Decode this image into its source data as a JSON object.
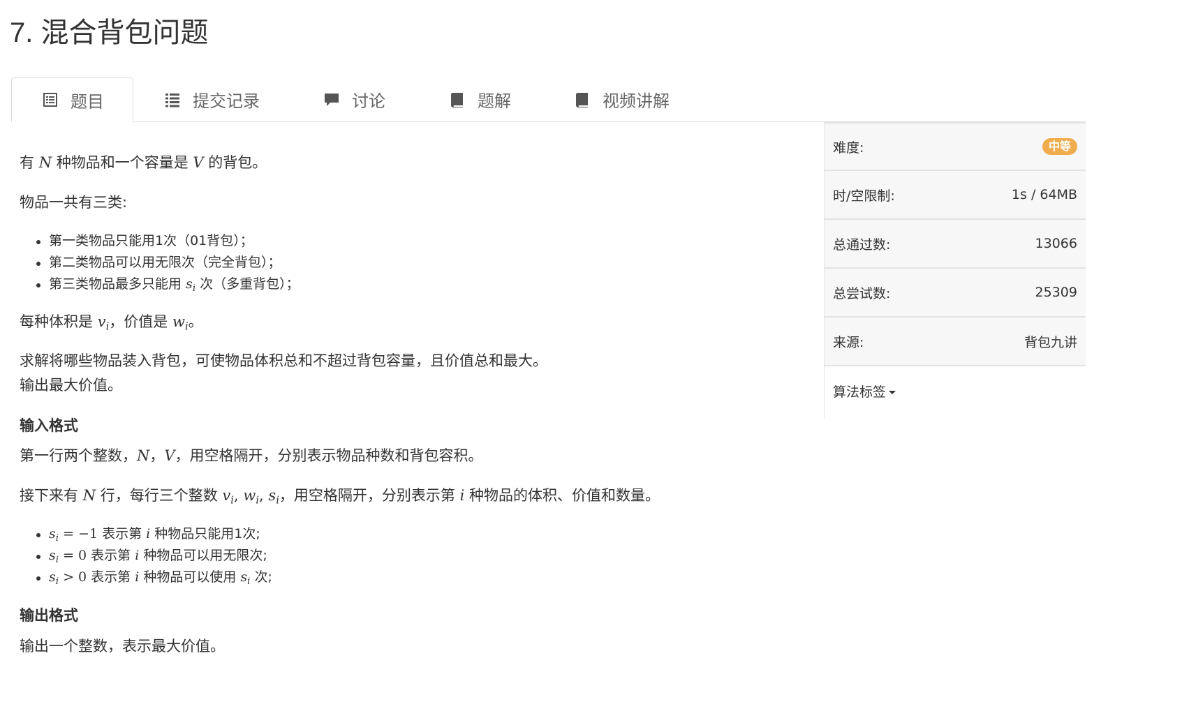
{
  "problem": {
    "title": "7. 混合背包问题"
  },
  "tabs": [
    {
      "label": "题目",
      "icon": "list-box-icon",
      "active": true
    },
    {
      "label": "提交记录",
      "icon": "list-icon"
    },
    {
      "label": "讨论",
      "icon": "comment-icon"
    },
    {
      "label": "题解",
      "icon": "book-icon"
    },
    {
      "label": "视频讲解",
      "icon": "book-icon"
    }
  ],
  "description": {
    "intro": {
      "pre": "有 ",
      "N": "N",
      "mid": " 种物品和一个容量是 ",
      "V": "V",
      "post": " 的背包。"
    },
    "categories_intro": "物品一共有三类:",
    "categories": [
      "第一类物品只能用1次（01背包）；",
      "第二类物品可以用无限次（完全背包）；",
      {
        "pre": "第三类物品最多只能用 ",
        "var": "s",
        "sub": "i",
        "post": " 次（多重背包）；"
      }
    ],
    "volume_value": {
      "pre": "每种体积是 ",
      "v": "v",
      "v_sub": "i",
      "mid": "，价值是 ",
      "w": "w",
      "w_sub": "i",
      "post": "。"
    },
    "goal_line1": "求解将哪些物品装入背包，可使物品体积总和不超过背包容量，且价值总和最大。",
    "goal_line2": "输出最大价值。"
  },
  "input_format": {
    "heading": "输入格式",
    "line1": {
      "pre": "第一行两个整数，",
      "N": "N",
      "sep": "，",
      "V": "V",
      "post": "，用空格隔开，分别表示物品种数和背包容积。"
    },
    "line2": {
      "pre": "接下来有 ",
      "N": "N",
      "mid": " 行，每行三个整数 ",
      "vars": "v",
      "vars_sub": "i",
      "w": "w",
      "w_sub": "i",
      "s": "s",
      "s_sub": "i",
      "mid2": "，用空格隔开，分别表示第 ",
      "i": "i",
      "post": " 种物品的体积、价值和数量。"
    },
    "rules": [
      {
        "cond": " = −1",
        "pre": " 表示第 ",
        "i": "i",
        "post": " 种物品只能用1次;"
      },
      {
        "cond": " = 0",
        "pre": " 表示第 ",
        "i": "i",
        "post": " 种物品可以用无限次;"
      },
      {
        "cond": " > 0",
        "pre": " 表示第 ",
        "i": "i",
        "post": " 种物品可以使用 ",
        "post2": " 次;"
      }
    ]
  },
  "output_format": {
    "heading": "输出格式",
    "line": "输出一个整数，表示最大价值。"
  },
  "sidebar": {
    "difficulty_label": "难度:",
    "difficulty_value": "中等",
    "difficulty_color": "#f0ad4e",
    "limit_label": "时/空限制:",
    "limit_value": "1s / 64MB",
    "passed_label": "总通过数:",
    "passed_value": "13066",
    "attempts_label": "总尝试数:",
    "attempts_value": "25309",
    "source_label": "来源:",
    "source_value": "背包九讲",
    "tags_label": "算法标签"
  }
}
